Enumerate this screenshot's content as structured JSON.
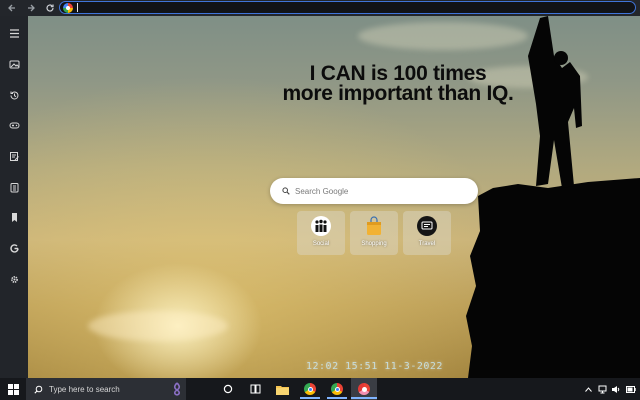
{
  "browser": {
    "address_value": ""
  },
  "page": {
    "quote_line1": "I CAN is 100 times",
    "quote_line2": "more important than IQ.",
    "search_placeholder": "Search Google",
    "shortcuts": [
      {
        "label": "Social",
        "icon": "social-people-icon"
      },
      {
        "label": "Shopping",
        "icon": "shopping-bag-icon"
      },
      {
        "label": "Travel",
        "icon": "travel-icon"
      }
    ],
    "clock_text": "12:02  15:51  11-3-2022"
  },
  "taskbar": {
    "search_placeholder": "Type here to search"
  },
  "colors": {
    "accent": "#3f74d9",
    "sidebar": "#22252a",
    "taskbar": "#16181c"
  }
}
